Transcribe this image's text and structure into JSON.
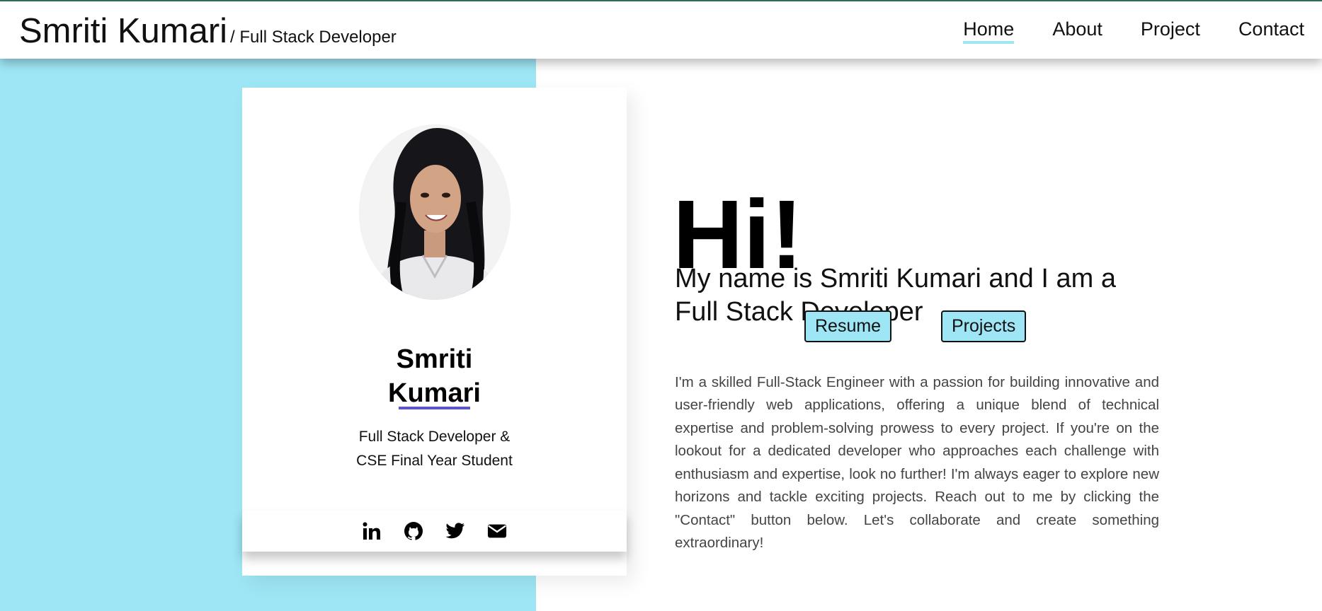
{
  "header": {
    "brand_name": "Smriti Kumari",
    "brand_sub": "/ Full Stack Developer",
    "nav": {
      "home": "Home",
      "about": "About",
      "project": "Project",
      "contact": "Contact"
    },
    "active_nav": "Home"
  },
  "card": {
    "avatar_icon": "profile-photo",
    "name_line1": "Smriti",
    "name_line2": "Kumari",
    "role_line1": "Full Stack Developer &",
    "role_line2": "CSE Final Year Student",
    "social_icons": [
      "linkedin-icon",
      "github-icon",
      "twitter-icon",
      "email-icon"
    ]
  },
  "hero": {
    "greeting": "Hi!",
    "intro_line1": "My name is Smriti Kumari and I am a",
    "intro_line2": "Full Stack Developer",
    "resume_button": "Resume",
    "projects_button": "Projects",
    "about": "I'm a skilled Full-Stack Engineer with a passion for building innovative and user-friendly web applications, offering a unique blend of technical expertise and problem-solving prowess to every project. If you're on the lookout for a dedicated developer who approaches each challenge with enthusiasm and expertise, look no further! I'm always eager to explore new horizons and tackle exciting projects. Reach out to me by clicking the \"Contact\" button below. Let's collaborate and create something extraordinary!"
  },
  "colors": {
    "accent_cyan": "#9ee6f5",
    "divider_purple": "#5b54d6",
    "header_top_border": "#2f6b57"
  }
}
